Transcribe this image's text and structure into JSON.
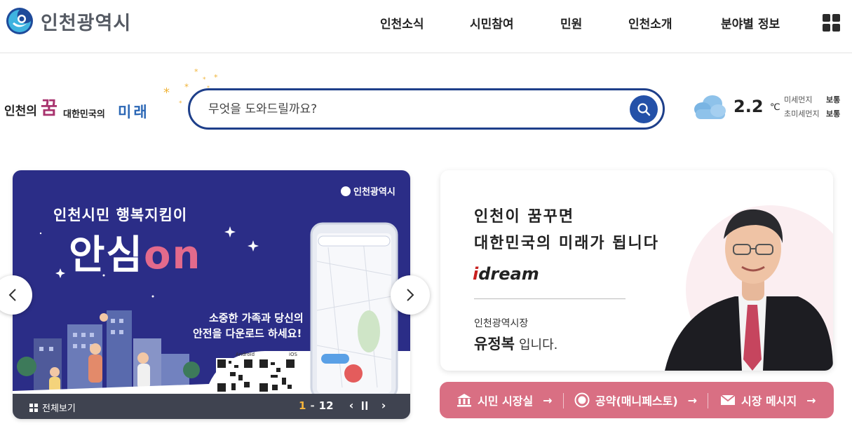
{
  "header": {
    "logo_text": "인천광역시",
    "nav": [
      "인천소식",
      "시민참여",
      "민원",
      "인천소개",
      "분야별 정보"
    ]
  },
  "slogan": {
    "part1": "인천의",
    "dream": "꿈",
    "part2": "대한민국의",
    "future": "미래"
  },
  "search": {
    "placeholder": "무엇을 도와드릴까요?"
  },
  "weather": {
    "temperature": "2.2",
    "unit": "℃",
    "fine_dust_label": "미세먼지",
    "fine_dust_value": "보통",
    "ultrafine_dust_label": "초미세먼지",
    "ultrafine_dust_value": "보통"
  },
  "banner": {
    "logo": "인천광역시",
    "subtitle": "인천시민 행복지킴이",
    "title_main": "안심",
    "title_accent": "on",
    "copy_line1": "소중한 가족과 당신의",
    "copy_line2": "안전을 다운로드 하세요!",
    "qr_android": "Android",
    "qr_ios": "iOS",
    "all_view": "전체보기",
    "page_current": "1",
    "page_sep": "-",
    "page_total": "12"
  },
  "mayor": {
    "line1": "인천이 꿈꾸면",
    "line2": "대한민국의 미래가 됩니다",
    "brand_i": "i",
    "brand_rest": "dream",
    "role": "인천광역시장",
    "name": "유정복",
    "name_suffix": "입니다."
  },
  "pink_bar": {
    "item1": "시민 시장실",
    "item2": "공약(매니페스토)",
    "item3": "시장 메시지"
  },
  "colors": {
    "brand_navy": "#1e3f8a",
    "banner_bg": "#2b2d87",
    "accent_pink": "#d96f83",
    "pager_accent": "#f5b43c"
  }
}
